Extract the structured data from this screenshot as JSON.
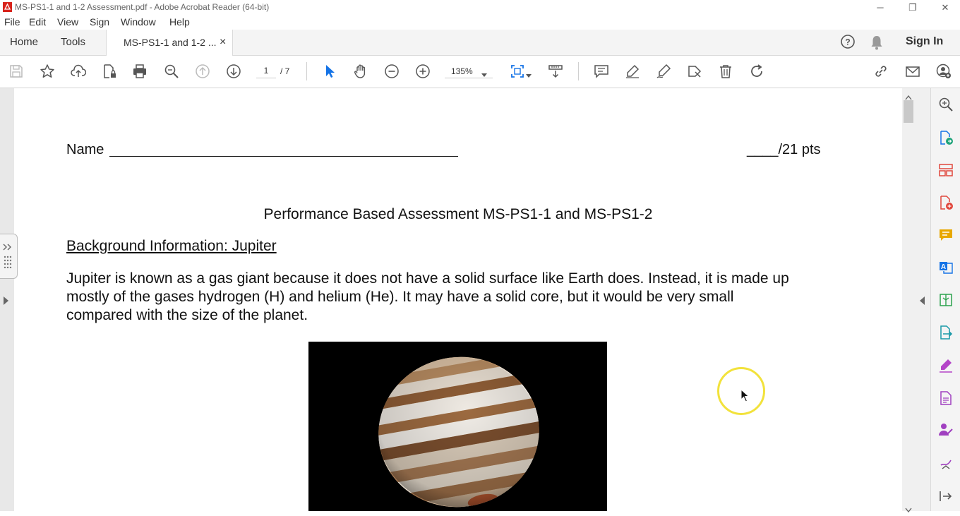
{
  "window": {
    "title": "MS-PS1-1 and 1-2 Assessment.pdf - Adobe Acrobat Reader (64-bit)",
    "controls": {
      "minimize": "─",
      "maximize": "❐",
      "close": "✕"
    }
  },
  "menu": {
    "items": [
      "File",
      "Edit",
      "View",
      "Sign",
      "Window",
      "Help"
    ]
  },
  "tabs": {
    "home": "Home",
    "tools": "Tools",
    "document": "MS-PS1-1 and 1-2 ...",
    "close": "×",
    "sign_in": "Sign In"
  },
  "toolbar": {
    "page_current": "1",
    "page_total": "/ 7",
    "zoom": "135%"
  },
  "document": {
    "name_label": "Name",
    "points": "____/21 pts",
    "heading": "Performance Based Assessment MS-PS1-1 and MS-PS1-2",
    "section_title": "Background Information: Jupiter",
    "paragraph_lines": [
      "Jupiter is known as a gas giant because it does not have a solid surface like Earth does. Instead, it is made up",
      "mostly of the gases hydrogen (H) and helium (He). It may have a solid core, but it would be very small",
      "compared with the size of the planet."
    ]
  },
  "colors": {
    "accent_blue": "#1473e6",
    "comment_yellow": "#e8a800",
    "export_red": "#e0463c",
    "sign_purple": "#a040c0",
    "cursor_ring": "#f2e23c"
  },
  "icons": {
    "toolbar": [
      "save-icon",
      "star-icon",
      "upload-icon",
      "file-lock-icon",
      "print-icon",
      "zoom-search-icon",
      "page-up-icon",
      "page-down-icon",
      "select-arrow-icon",
      "hand-icon",
      "zoom-out-icon",
      "zoom-in-icon",
      "fit-page-icon",
      "scroll-mode-icon",
      "comment-icon",
      "highlight-icon",
      "draw-icon",
      "stamp-icon",
      "delete-icon",
      "rotate-icon",
      "share-link-icon",
      "email-icon",
      "add-user-icon"
    ],
    "right_panel": [
      "search-zoom-icon",
      "export-pdf-icon",
      "organize-icon",
      "create-pdf-icon",
      "comment-icon",
      "edit-pdf-icon",
      "compress-icon",
      "export-icon",
      "fill-sign-icon",
      "send-pdf-icon",
      "sign-icon",
      "protect-icon",
      "collapse-icon"
    ]
  }
}
